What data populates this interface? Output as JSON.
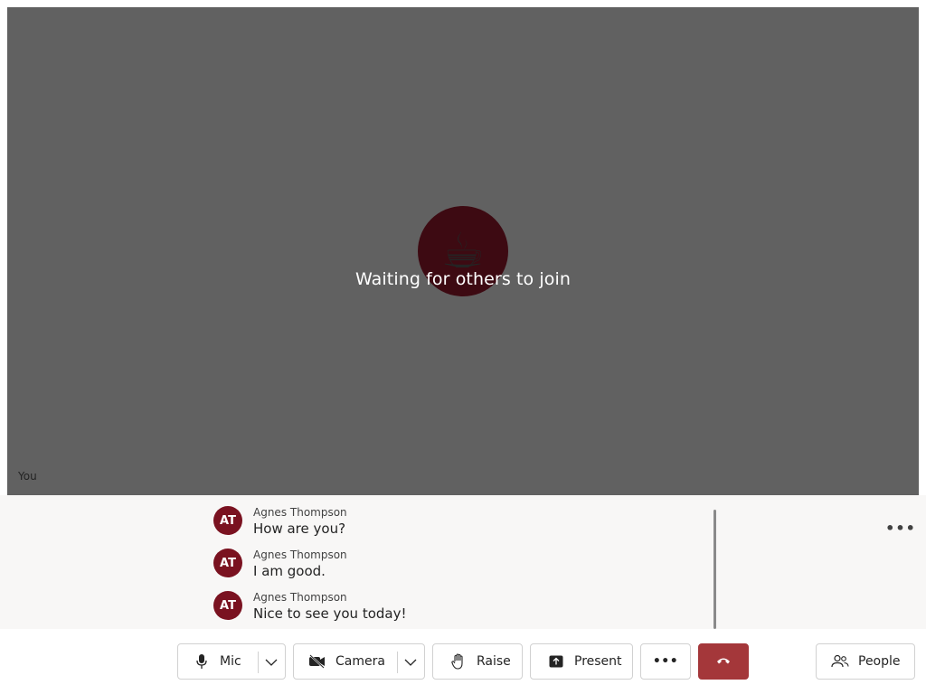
{
  "stage": {
    "avatar_emoji": "☕",
    "waiting_text": "Waiting for others to join",
    "self_label": "You"
  },
  "chat": {
    "messages": [
      {
        "initials": "AT",
        "sender": "Agnes Thompson",
        "text": "How are you?"
      },
      {
        "initials": "AT",
        "sender": "Agnes Thompson",
        "text": "I am good."
      },
      {
        "initials": "AT",
        "sender": "Agnes Thompson",
        "text": "Nice to see you today!"
      }
    ],
    "more_label": "•••"
  },
  "toolbar": {
    "mic_label": "Mic",
    "camera_label": "Camera",
    "raise_label": "Raise",
    "present_label": "Present",
    "more_label": "•••",
    "people_label": "People"
  },
  "colors": {
    "stage_bg": "#616161",
    "avatar_bg": "#3d0a12",
    "initials_bg": "#7a1220",
    "leave_bg": "#a4373a"
  }
}
